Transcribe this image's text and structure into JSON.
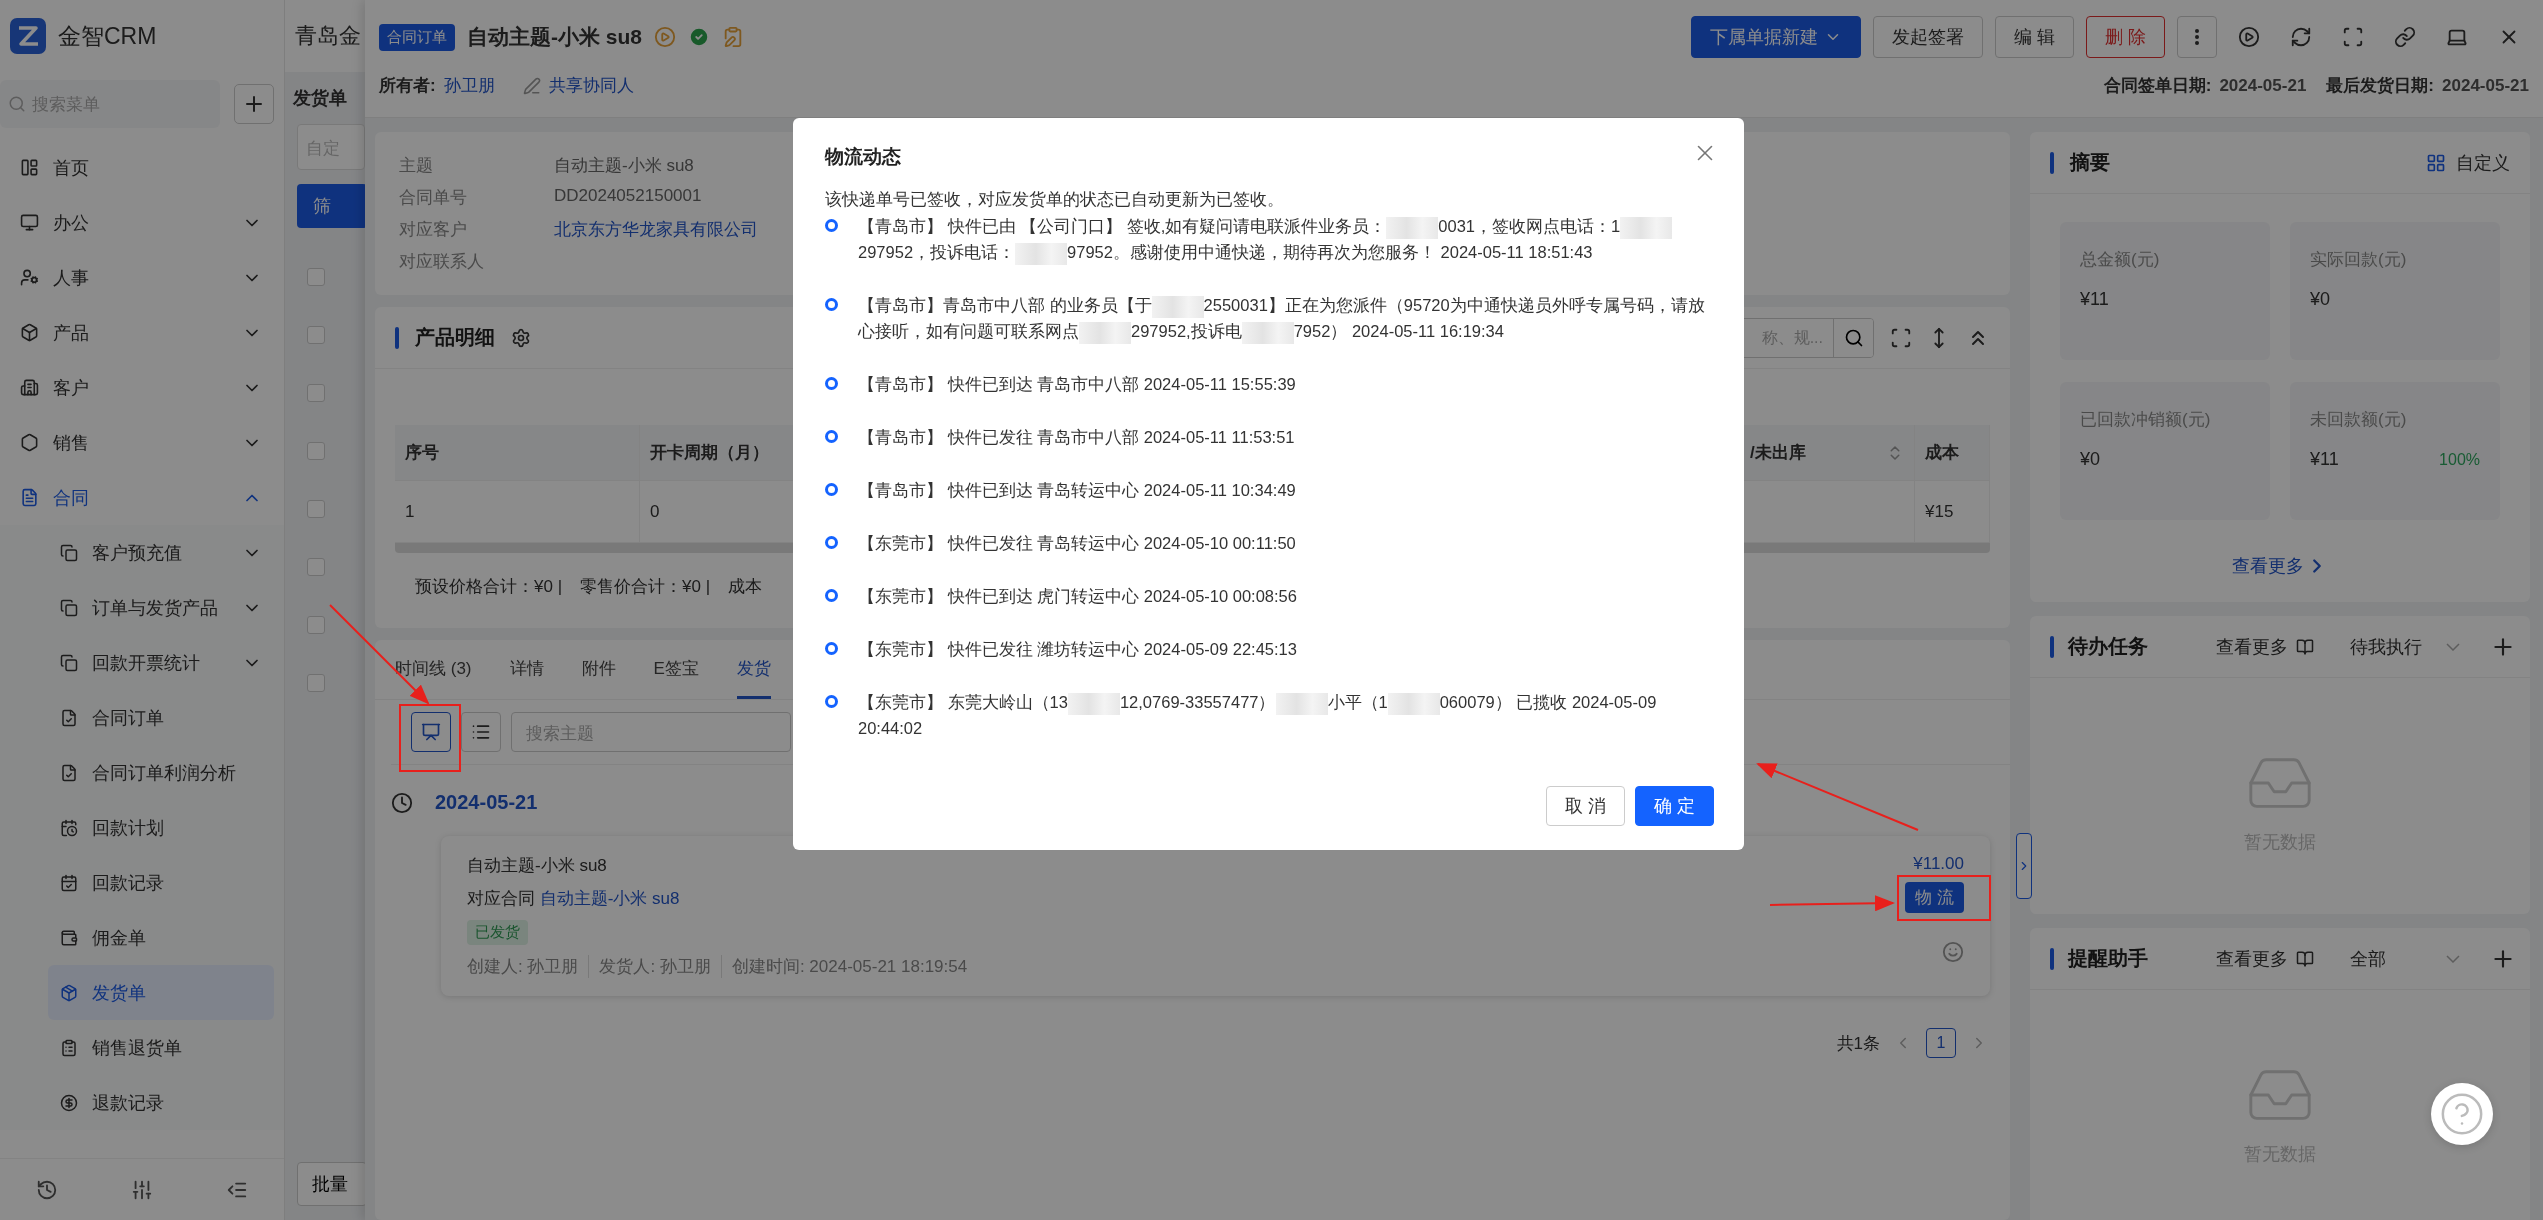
{
  "sidebar": {
    "logo": "金智CRM",
    "search": {
      "placeholder": "搜索菜单"
    },
    "items": [
      {
        "label": "首页",
        "expandable": false,
        "expanded": false,
        "selected": false
      },
      {
        "label": "办公",
        "expandable": true,
        "expanded": false,
        "selected": false
      },
      {
        "label": "人事",
        "expandable": true,
        "expanded": false,
        "selected": false
      },
      {
        "label": "产品",
        "expandable": true,
        "expanded": false,
        "selected": false
      },
      {
        "label": "客户",
        "expandable": true,
        "expanded": false,
        "selected": false
      },
      {
        "label": "销售",
        "expandable": true,
        "expanded": false,
        "selected": false
      },
      {
        "label": "合同",
        "expandable": true,
        "expanded": true,
        "selected": false,
        "children": [
          {
            "label": "客户预充值",
            "expandable": true,
            "selected": false
          },
          {
            "label": "订单与发货产品",
            "expandable": true,
            "selected": false
          },
          {
            "label": "回款开票统计",
            "expandable": true,
            "selected": false
          },
          {
            "label": "合同订单",
            "expandable": false,
            "selected": false
          },
          {
            "label": "合同订单利润分析",
            "expandable": false,
            "selected": false
          },
          {
            "label": "回款计划",
            "expandable": false,
            "selected": false
          },
          {
            "label": "回款记录",
            "expandable": false,
            "selected": false
          },
          {
            "label": "佣金单",
            "expandable": false,
            "selected": false
          },
          {
            "label": "发货单",
            "expandable": false,
            "selected": true
          },
          {
            "label": "销售退货单",
            "expandable": false,
            "selected": false
          },
          {
            "label": "退款记录",
            "expandable": false,
            "selected": false
          }
        ]
      }
    ]
  },
  "list_page": {
    "title": "青岛金",
    "heading": "发货单",
    "filter_placeholder": "自定",
    "filter_button": "筛",
    "batch_button": "批量",
    "rows": [
      {
        "checked": false
      },
      {
        "checked": false
      },
      {
        "checked": false
      },
      {
        "checked": false
      },
      {
        "checked": false
      },
      {
        "checked": false
      },
      {
        "checked": false
      },
      {
        "checked": false
      }
    ]
  },
  "drawer": {
    "tag": "合同订单",
    "title": "自动主题-小米 su8",
    "buttons": [
      {
        "label": "下属单据新建",
        "kind": "primary",
        "dropdown": true
      },
      {
        "label": "发起签署",
        "kind": "default"
      },
      {
        "label": "编 辑",
        "kind": "default"
      },
      {
        "label": "删 除",
        "kind": "danger"
      }
    ],
    "owner_label": "所有者:",
    "owner": "孙卫朋",
    "share": "共享协同人",
    "dates": [
      {
        "label": "合同签单日期:",
        "value": "2024-05-21"
      },
      {
        "label": "最后发货日期:",
        "value": "2024-05-21"
      }
    ]
  },
  "info": {
    "fields": [
      {
        "label": "主题",
        "value": "自动主题-小米 su8",
        "kind": "text"
      },
      {
        "label": "合同单号",
        "value": "DD2024052150001",
        "kind": "text"
      },
      {
        "label": "对应客户",
        "value": "北京东方华龙家具有限公司",
        "kind": "link"
      },
      {
        "label": "对应联系人"
      }
    ]
  },
  "products": {
    "title": "产品明细",
    "search_placeholder": "称、规...",
    "columns": [
      {
        "label": "序号"
      },
      {
        "label": "开卡周期（月）"
      },
      {
        "label": "/未出库",
        "sortable": true
      },
      {
        "label": "成本"
      }
    ],
    "rows": [
      [
        "1",
        "0",
        null,
        "¥15"
      ]
    ],
    "totals": [
      "预设价格合计：¥0 |",
      "零售价合计：¥0 |",
      "成本"
    ]
  },
  "records": {
    "tabs": [
      {
        "label": "时间线 (3)",
        "selected": false
      },
      {
        "label": "详情",
        "selected": false
      },
      {
        "label": "附件",
        "selected": false
      },
      {
        "label": "E签宝",
        "selected": false
      },
      {
        "label": "发货",
        "selected": true
      }
    ],
    "views": [
      {
        "selected": true
      },
      {
        "selected": false
      }
    ],
    "search_placeholder": "搜索主题",
    "date": "2024-05-21",
    "items": [
      {
        "title": "自动主题-小米 su8",
        "contract_label": "对应合同",
        "contract": "自动主题-小米 su8",
        "status": "已发货",
        "meta": [
          "创建人: 孙卫朋",
          "发货人: 孙卫朋",
          "创建时间: 2024-05-21 18:19:54"
        ],
        "amount": "¥11.00",
        "action": "物 流"
      }
    ],
    "pagination": {
      "total": "共1条",
      "pages": [
        {
          "label": "1",
          "selected": true
        }
      ]
    }
  },
  "summary": {
    "title": "摘要",
    "customize": "自定义",
    "stats": [
      {
        "label": "总金额(元)",
        "value": "¥11"
      },
      {
        "label": "实际回款(元)",
        "value": "¥0"
      },
      {
        "label": "已回款冲销额(元)",
        "value": "¥0"
      },
      {
        "label": "未回款额(元)",
        "value": "¥11",
        "percent": "100%"
      }
    ],
    "more": "查看更多"
  },
  "panels": [
    {
      "title": "待办任务",
      "more": "查看更多",
      "filter": "待我执行",
      "empty": "暂无数据"
    },
    {
      "title": "提醒助手",
      "more": "查看更多",
      "filter": "全部",
      "empty": "暂无数据"
    }
  ],
  "modal": {
    "title": "物流动态",
    "notice": "该快递单号已签收，对应发货单的状态已自动更新为已签收。",
    "events": [
      {
        "parts": [
          "【青岛市】 快件已由 【公司门口】 签收,如有疑问请电联派件业务员：",
          "0031，签收网点电话：1",
          "297952，投诉电话：",
          "97952。感谢使用中通快递，期待再次为您服务！ 2024-05-11 18:51:43"
        ]
      },
      {
        "parts": [
          "【青岛市】青岛市中八部 的业务员【于",
          "2550031】正在为您派件（95720为中通快递员外呼专属号码，请放心接听，如有问题可联系网点",
          "297952,投诉电",
          "7952） 2024-05-11 16:19:34"
        ]
      },
      {
        "parts": [
          "【青岛市】 快件已到达 青岛市中八部 2024-05-11 15:55:39"
        ]
      },
      {
        "parts": [
          "【青岛市】 快件已发往 青岛市中八部 2024-05-11 11:53:51"
        ]
      },
      {
        "parts": [
          "【青岛市】 快件已到达 青岛转运中心 2024-05-11 10:34:49"
        ]
      },
      {
        "parts": [
          "【东莞市】 快件已发往 青岛转运中心 2024-05-10 00:11:50"
        ]
      },
      {
        "parts": [
          "【东莞市】 快件已到达 虎门转运中心 2024-05-10 00:08:56"
        ]
      },
      {
        "parts": [
          "【东莞市】 快件已发往 潍坊转运中心 2024-05-09 22:45:13"
        ]
      },
      {
        "parts": [
          "【东莞市】 东莞大岭山（13",
          "12,0769-33557477）",
          "小平（1",
          "060079） 已揽收 2024-05-09 20:44:02"
        ]
      }
    ],
    "buttons": [
      {
        "label": "取 消",
        "kind": "default"
      },
      {
        "label": "确 定",
        "kind": "primary"
      }
    ]
  }
}
